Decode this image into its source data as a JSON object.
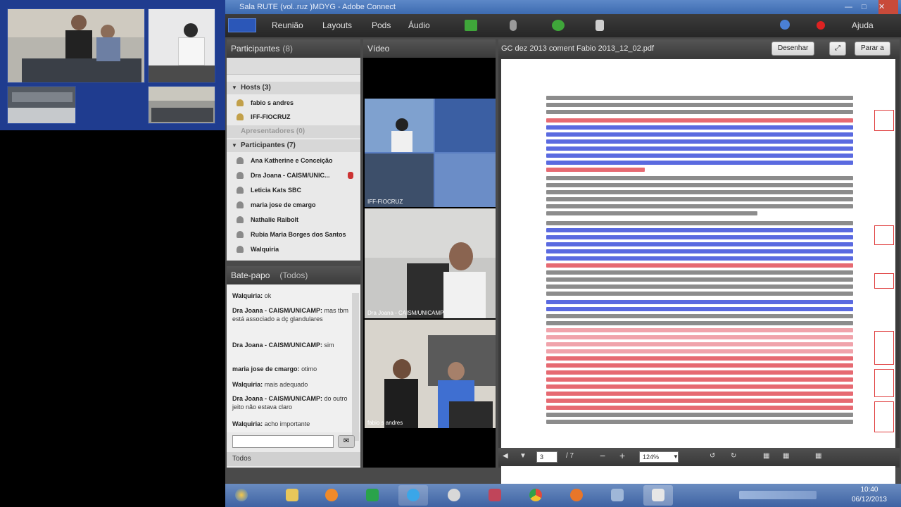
{
  "window": {
    "title": "Sala RUTE (vol..ruz )MDYG - Adobe Connect"
  },
  "menubar": {
    "items": [
      "Reunião",
      "Layouts",
      "Pods",
      "Áudio"
    ],
    "help": "Ajuda"
  },
  "attendees": {
    "title": "Participantes",
    "count": "(8)",
    "hosts_group": "Hosts (3)",
    "hosts": [
      "fabio s andres",
      "IFF-FIOCRUZ"
    ],
    "presenters_group": "Apresentadores (0)",
    "participants_group": "Participantes (7)",
    "participants": [
      "Ana Katherine e Conceição",
      "Dra Joana - CAISM/UNIC...",
      "Leticia Kats SBC",
      "maria jose de cmargo",
      "Nathalie Raibolt",
      "Rubia Maria Borges dos Santos",
      "Walquiria"
    ]
  },
  "chat": {
    "title": "Bate-papo",
    "scope": "(Todos)",
    "messages": [
      {
        "author": "Walquiria:",
        "text": "ok"
      },
      {
        "author": "Dra Joana - CAISM/UNICAMP:",
        "text": "mas tbm está associado a dç glandulares"
      },
      {
        "author": "Dra Joana - CAISM/UNICAMP:",
        "text": "sim"
      },
      {
        "author": "maria jose de cmargo:",
        "text": "otimo"
      },
      {
        "author": "Walquiria:",
        "text": "mais adequado"
      },
      {
        "author": "Dra Joana - CAISM/UNICAMP:",
        "text": "do outro jeito não estava claro"
      },
      {
        "author": "Walquiria:",
        "text": "acho importante"
      }
    ],
    "recipient": "Todos",
    "send_icon": "chat-bubble-icon"
  },
  "video": {
    "title": "Vídeo",
    "feeds": [
      "IFF-FIOCRUZ",
      "Dra Joana - CAISM/UNICAMP",
      "fabio s andres"
    ]
  },
  "share": {
    "title": "GC dez 2013 coment Fabio 2013_12_02.pdf",
    "draw_button": "Desenhar",
    "stop_button": "Parar a",
    "page_current": "3",
    "page_total": "/ 7",
    "zoom": "124%"
  },
  "taskbar": {
    "time": "10:40",
    "date": "06/12/2013"
  },
  "colors": {
    "accent_blue": "#2b57b8",
    "doc_red": "#d21f2a",
    "doc_blue": "#2b3fd0",
    "highlight_pink": "#f7b5bd"
  }
}
